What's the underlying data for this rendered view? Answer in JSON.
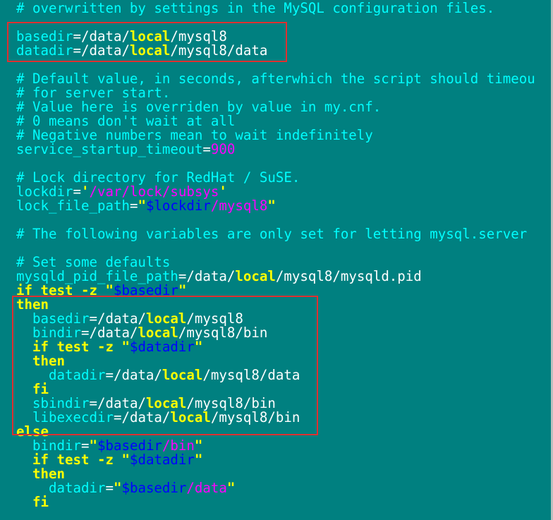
{
  "colors": {
    "background": "#008080",
    "comment": "#00FFFF",
    "plain": "#FFFFFF",
    "keyword": "#FFFF00",
    "string": "#FF00FF",
    "variable": "#0000FF",
    "highlight_box": "#E03030"
  },
  "editor": {
    "lines": [
      [
        {
          "t": "# overwritten by settings in the MySQL configuration files.",
          "k": "c"
        }
      ],
      [],
      [
        {
          "t": "basedir",
          "k": "c"
        },
        {
          "t": "=/data/",
          "k": "w"
        },
        {
          "t": "local",
          "k": "y"
        },
        {
          "t": "/mysql8",
          "k": "w"
        }
      ],
      [
        {
          "t": "datadir",
          "k": "c"
        },
        {
          "t": "=/data/",
          "k": "w"
        },
        {
          "t": "local",
          "k": "y"
        },
        {
          "t": "/mysql8/data",
          "k": "w"
        }
      ],
      [],
      [
        {
          "t": "# Default value, in seconds, afterwhich the script should timeou",
          "k": "c"
        }
      ],
      [
        {
          "t": "# for server start.",
          "k": "c"
        }
      ],
      [
        {
          "t": "# Value here is overriden by value in my.cnf.",
          "k": "c"
        }
      ],
      [
        {
          "t": "# 0 means don't wait at all",
          "k": "c"
        }
      ],
      [
        {
          "t": "# Negative numbers mean to wait indefinitely",
          "k": "c"
        }
      ],
      [
        {
          "t": "service_startup_timeout",
          "k": "c"
        },
        {
          "t": "=",
          "k": "w"
        },
        {
          "t": "900",
          "k": "m"
        }
      ],
      [],
      [
        {
          "t": "# Lock directory for RedHat / SuSE.",
          "k": "c"
        }
      ],
      [
        {
          "t": "lockdir",
          "k": "c"
        },
        {
          "t": "=",
          "k": "w"
        },
        {
          "t": "'",
          "k": "y"
        },
        {
          "t": "/var/lock/subsys",
          "k": "m"
        },
        {
          "t": "'",
          "k": "y"
        }
      ],
      [
        {
          "t": "lock_file_path",
          "k": "c"
        },
        {
          "t": "=",
          "k": "w"
        },
        {
          "t": "\"",
          "k": "y"
        },
        {
          "t": "$lockdir",
          "k": "b"
        },
        {
          "t": "/mysql8",
          "k": "m"
        },
        {
          "t": "\"",
          "k": "y"
        }
      ],
      [],
      [
        {
          "t": "# The following variables are only set for letting mysql.server",
          "k": "c"
        }
      ],
      [],
      [
        {
          "t": "# Set some defaults",
          "k": "c"
        }
      ],
      [
        {
          "t": "mysqld_pid_file_path",
          "k": "c"
        },
        {
          "t": "=/data/",
          "k": "w"
        },
        {
          "t": "local",
          "k": "y"
        },
        {
          "t": "/mysql8/mysqld.pid",
          "k": "w"
        }
      ],
      [
        {
          "t": "if test -z ",
          "k": "y"
        },
        {
          "t": "\"",
          "k": "y"
        },
        {
          "t": "$basedir",
          "k": "b"
        },
        {
          "t": "\"",
          "k": "y"
        }
      ],
      [
        {
          "t": "then",
          "k": "y"
        }
      ],
      [
        {
          "t": "  basedir",
          "k": "c"
        },
        {
          "t": "=/data/",
          "k": "w"
        },
        {
          "t": "local",
          "k": "y"
        },
        {
          "t": "/mysql8",
          "k": "w"
        }
      ],
      [
        {
          "t": "  bindir",
          "k": "c"
        },
        {
          "t": "=/data/",
          "k": "w"
        },
        {
          "t": "local",
          "k": "y"
        },
        {
          "t": "/mysql8/bin",
          "k": "w"
        }
      ],
      [
        {
          "t": "  if test -z ",
          "k": "y"
        },
        {
          "t": "\"",
          "k": "y"
        },
        {
          "t": "$datadir",
          "k": "b"
        },
        {
          "t": "\"",
          "k": "y"
        }
      ],
      [
        {
          "t": "  then",
          "k": "y"
        }
      ],
      [
        {
          "t": "    datadir",
          "k": "c"
        },
        {
          "t": "=/data/",
          "k": "w"
        },
        {
          "t": "local",
          "k": "y"
        },
        {
          "t": "/mysql8/data",
          "k": "w"
        }
      ],
      [
        {
          "t": "  fi",
          "k": "y"
        }
      ],
      [
        {
          "t": "  sbindir",
          "k": "c"
        },
        {
          "t": "=/data/",
          "k": "w"
        },
        {
          "t": "local",
          "k": "y"
        },
        {
          "t": "/mysql8/bin",
          "k": "w"
        }
      ],
      [
        {
          "t": "  libexecdir",
          "k": "c"
        },
        {
          "t": "=/data/",
          "k": "w"
        },
        {
          "t": "local",
          "k": "y"
        },
        {
          "t": "/mysql8/bin",
          "k": "w"
        }
      ],
      [
        {
          "t": "else",
          "k": "y"
        }
      ],
      [
        {
          "t": "  bindir",
          "k": "c"
        },
        {
          "t": "=",
          "k": "w"
        },
        {
          "t": "\"",
          "k": "y"
        },
        {
          "t": "$basedir",
          "k": "b"
        },
        {
          "t": "/bin",
          "k": "m"
        },
        {
          "t": "\"",
          "k": "y"
        }
      ],
      [
        {
          "t": "  if test -z ",
          "k": "y"
        },
        {
          "t": "\"",
          "k": "y"
        },
        {
          "t": "$datadir",
          "k": "b"
        },
        {
          "t": "\"",
          "k": "y"
        }
      ],
      [
        {
          "t": "  then",
          "k": "y"
        }
      ],
      [
        {
          "t": "    datadir",
          "k": "c"
        },
        {
          "t": "=",
          "k": "w"
        },
        {
          "t": "\"",
          "k": "y"
        },
        {
          "t": "$basedir",
          "k": "b"
        },
        {
          "t": "/data",
          "k": "m"
        },
        {
          "t": "\"",
          "k": "y"
        }
      ],
      [
        {
          "t": "  fi",
          "k": "y"
        }
      ]
    ]
  }
}
